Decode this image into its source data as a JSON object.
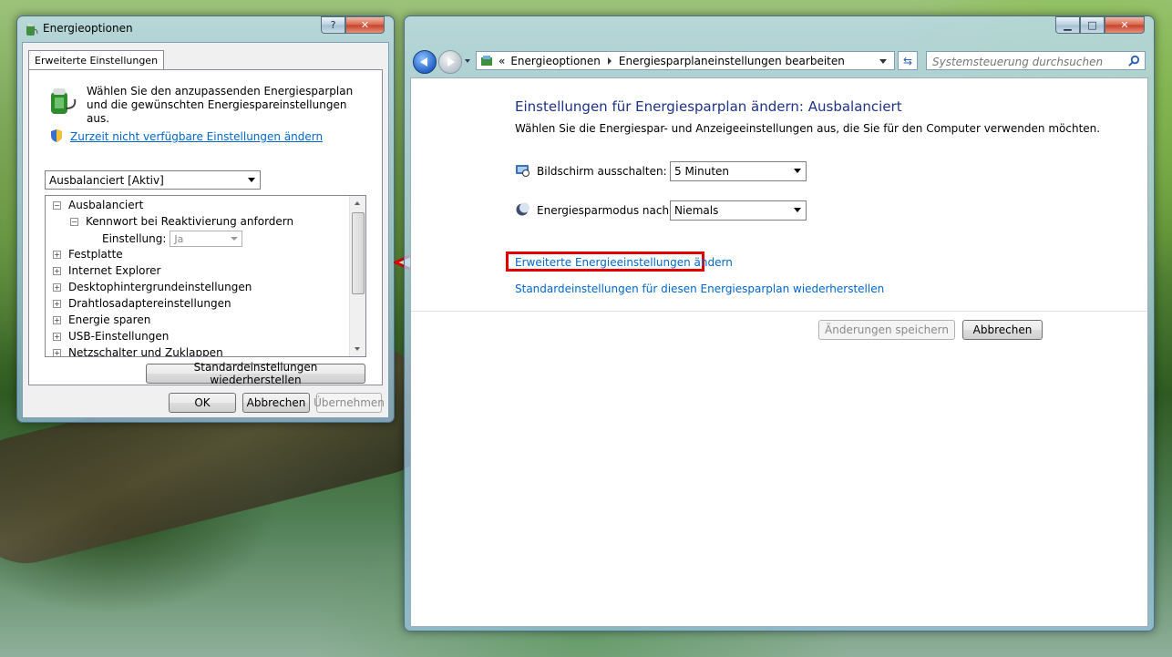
{
  "left_window": {
    "title": "Energieoptionen",
    "help_button": "?",
    "close_button": "✕",
    "tab": "Erweiterte Einstellungen",
    "description": "Wählen Sie den anzupassenden Energiesparplan und die gewünschten Energiespareinstellungen aus.",
    "change_link": "Zurzeit nicht verfügbare Einstellungen ändern",
    "plan_select": "Ausbalanciert [Aktiv]",
    "tree": {
      "root": "Ausbalanciert",
      "child": "Kennwort bei Reaktivierung anfordern",
      "setting_label": "Einstellung:",
      "setting_value": "Ja",
      "items": [
        "Festplatte",
        "Internet Explorer",
        "Desktophintergrundeinstellungen",
        "Drahtlosadaptereinstellungen",
        "Energie sparen",
        "USB-Einstellungen",
        "Netzschalter und Zuklappen"
      ]
    },
    "restore_button": "Standardeinstellungen wiederherstellen",
    "ok_button": "OK",
    "cancel_button": "Abbrechen",
    "apply_button": "Übernehmen"
  },
  "right_window": {
    "minimize": "▁",
    "maximize": "□",
    "close": "✕",
    "breadcrumb": {
      "prefix": "«",
      "items": [
        "Energieoptionen",
        "Energiesparplaneinstellungen bearbeiten"
      ]
    },
    "search_placeholder": "Systemsteuerung durchsuchen",
    "heading": "Einstellungen für Energiesparplan ändern: Ausbalanciert",
    "subheading": "Wählen Sie die Energiespar- und Anzeigeeinstellungen aus, die Sie für den Computer verwenden möchten.",
    "display_off_label": "Bildschirm ausschalten:",
    "display_off_value": "5 Minuten",
    "sleep_label": "Energiesparmodus nach:",
    "sleep_value": "Niemals",
    "advanced_link": "Erweiterte Energieeinstellungen ändern",
    "restore_link": "Standardeinstellungen für diesen Energiesparplan wiederherstellen",
    "save_button": "Änderungen speichern",
    "cancel_button": "Abbrechen"
  },
  "colors": {
    "highlight_red": "#e00000",
    "link_blue": "#0066cc",
    "heading_blue": "#1e3287"
  }
}
